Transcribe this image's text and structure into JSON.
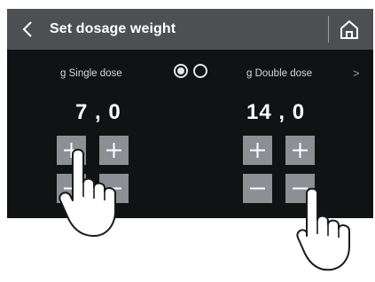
{
  "header": {
    "title": "Set dosage weight",
    "back_icon": "chevron-left-icon",
    "home_icon": "home-icon"
  },
  "single_dose": {
    "label": "g Single dose",
    "value": "7 , 0",
    "buttons": [
      "plus",
      "plus",
      "minus",
      "minus"
    ]
  },
  "double_dose": {
    "label": "g Double dose",
    "value": "14 , 0",
    "buttons": [
      "plus",
      "plus",
      "minus",
      "minus"
    ]
  },
  "page_indicator": {
    "pages": 2,
    "active": 1
  },
  "next_arrow": ">",
  "colors": {
    "screen_bg": "#111214",
    "header_bg": "#4d4f53",
    "button_bg": "#8d8f94",
    "text": "#ffffff"
  }
}
